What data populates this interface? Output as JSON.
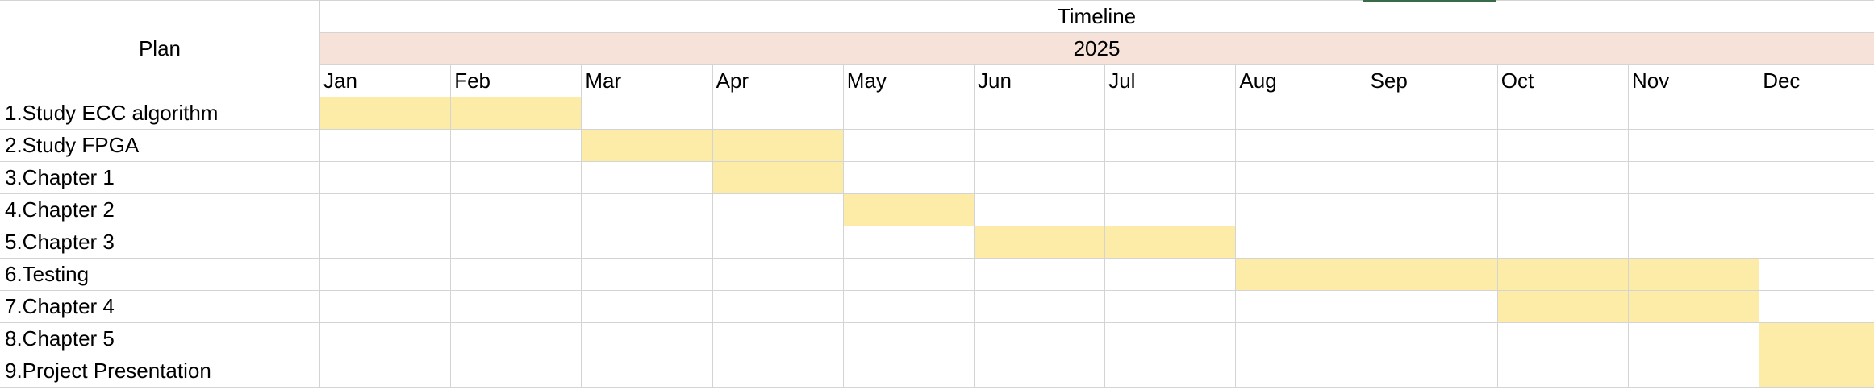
{
  "sheet": {
    "plan_header": "Plan",
    "timeline_header": "Timeline",
    "year": "2025",
    "months": [
      "Jan",
      "Feb",
      "Mar",
      "Apr",
      "May",
      "Jun",
      "Jul",
      "Aug",
      "Sep",
      "Oct",
      "Nov",
      "Dec"
    ],
    "tasks": [
      {
        "label": "1.Study ECC algorithm",
        "start": 1,
        "end": 2
      },
      {
        "label": "2.Study FPGA",
        "start": 3,
        "end": 4
      },
      {
        "label": "3.Chapter 1",
        "start": 4,
        "end": 4
      },
      {
        "label": "4.Chapter 2",
        "start": 5,
        "end": 5
      },
      {
        "label": "5.Chapter 3",
        "start": 6,
        "end": 7
      },
      {
        "label": "6.Testing",
        "start": 8,
        "end": 11
      },
      {
        "label": "7.Chapter 4",
        "start": 10,
        "end": 11
      },
      {
        "label": "8.Chapter 5",
        "start": 12,
        "end": 12
      },
      {
        "label": "9.Project Presentation",
        "start": 12,
        "end": 12
      }
    ],
    "colors": {
      "year_band": "#f6e2d8",
      "task_fill": "#fdeba8",
      "grid": "#d4d4d4"
    }
  }
}
